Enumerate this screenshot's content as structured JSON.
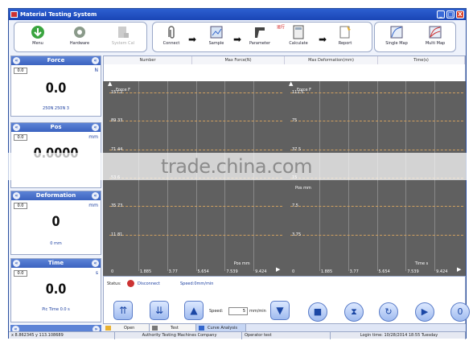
{
  "window": {
    "title": "Material Testing System",
    "buttons": [
      "_",
      "□",
      "X"
    ]
  },
  "toolbar": {
    "menu": "Menu",
    "hardware": "Hardware",
    "system_cal": "System Cal",
    "connect": "Connect",
    "sample": "Sample",
    "parameter": "Parameter",
    "calculate": "Calculate",
    "report": "Report",
    "single_map": "Single Map",
    "multi_map": "Multi Map",
    "calc_badge": "运行"
  },
  "panels": {
    "force": {
      "title": "Force",
      "box": "0.0",
      "unit": "N",
      "value": "0.0",
      "sub": "250N 250N 3"
    },
    "pos": {
      "title": "Pos",
      "box": "0.0",
      "unit": "mm",
      "value": "0.0000"
    },
    "deformation": {
      "title": "Deformation",
      "box": "0.0",
      "unit": "mm",
      "value": "0",
      "sub": "0 mm"
    },
    "time": {
      "title": "Time",
      "box": "0.0",
      "unit": "s",
      "value": "0.0",
      "sub": "Pic Time 0.0 s"
    }
  },
  "table": {
    "headers": [
      "Number",
      "Max Force(N)",
      "Max Deformation(mm)",
      "Time(s)"
    ]
  },
  "chart_data": [
    {
      "type": "line",
      "title": "",
      "ylabel": "Force F",
      "xlabel": "Pos mm",
      "yticks": [
        "157.2",
        "89.33",
        "71.44",
        "53.6",
        "35.73",
        "11.81"
      ],
      "xticks": [
        "0",
        "1.885",
        "3.77",
        "5.654",
        "7.539",
        "9.424"
      ],
      "series": []
    },
    {
      "type": "line",
      "title": "",
      "ylabel": "Force F",
      "ylabel2": "Pos mm",
      "xlabel": "Time s",
      "yticks": [
        "112.5",
        "75",
        "37.5",
        "15",
        "7.5",
        "3.75"
      ],
      "xticks": [
        "0",
        "1.885",
        "3.77",
        "5.654",
        "7.539",
        "9.424"
      ],
      "series": []
    }
  ],
  "control": {
    "status_label": "Status:",
    "status_value": "Disconnect",
    "speed_display": "Speed:0mm/min",
    "speed_label": "Speed:",
    "speed_value": "5",
    "speed_unit": "mm/min"
  },
  "tabs": [
    "Open",
    "Test",
    "Curve Analysis"
  ],
  "status": {
    "coords": "x 8.862345 y 113.108689",
    "company": "Authority Testing Machines Company",
    "operator": "Operator test",
    "login": "Login time: 10/28/2014 18:55 Tuesday"
  },
  "watermark": "trade.china.com",
  "colors": {
    "panel_header": "#3b63c0",
    "chart_bg": "#606060",
    "titlebar": "#1a45b5"
  }
}
